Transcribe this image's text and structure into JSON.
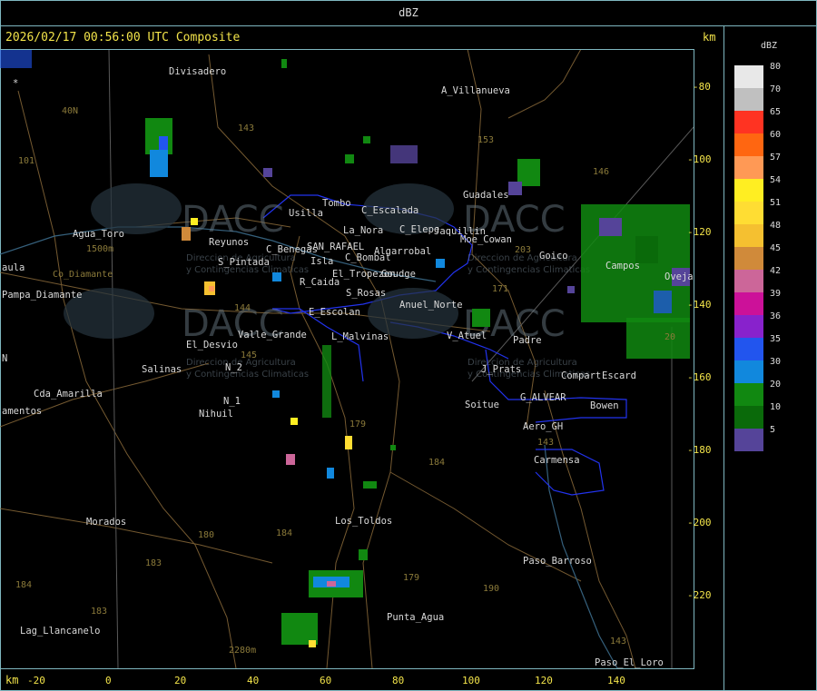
{
  "header": {
    "unit_title": "dBZ",
    "timestamp": "2026/02/17 00:56:00 UTC Composite",
    "km_top": "km",
    "km_bottom": "km"
  },
  "legend": {
    "title": "dBZ",
    "items": [
      {
        "value": "80",
        "color": "#e8e8e8"
      },
      {
        "value": "70",
        "color": "#c0c0c0"
      },
      {
        "value": "65",
        "color": "#ff3322"
      },
      {
        "value": "60",
        "color": "#ff6611"
      },
      {
        "value": "57",
        "color": "#ff9955"
      },
      {
        "value": "54",
        "color": "#ffee22"
      },
      {
        "value": "51",
        "color": "#ffdd33"
      },
      {
        "value": "48",
        "color": "#f5c030"
      },
      {
        "value": "45",
        "color": "#d08a3a"
      },
      {
        "value": "42",
        "color": "#cc6699"
      },
      {
        "value": "39",
        "color": "#cc1199"
      },
      {
        "value": "36",
        "color": "#8822cc"
      },
      {
        "value": "35",
        "color": "#2255ee"
      },
      {
        "value": "30",
        "color": "#1188dd"
      },
      {
        "value": "20",
        "color": "#118811"
      },
      {
        "value": "10",
        "color": "#0a6a0a"
      },
      {
        "value": "5",
        "color": "#554499"
      }
    ]
  },
  "axes": {
    "x_ticks": [
      "-20",
      "0",
      "20",
      "40",
      "60",
      "80",
      "100",
      "120",
      "140"
    ],
    "y_ticks": [
      "-80",
      "-100",
      "-120",
      "-140",
      "-160",
      "-180",
      "-200",
      "-220"
    ]
  },
  "places": [
    "Divisadero",
    "A_Villanueva",
    "40N",
    "101",
    "Agua_Toro",
    "1500m",
    "aula",
    "Co_Diamante",
    "Pampa_Diamante",
    "Reyunos",
    "S_Pintada",
    "Usilla",
    "Tombo",
    "C_Escalada",
    "La_Nora",
    "C_Elepe",
    "Jaquillin",
    "Moe_Cowan",
    "SAN_RAFAEL",
    "Algarrobal",
    "C_Benegas",
    "C_Bombal",
    "Isla",
    "El_Tropezon",
    "Goudge",
    "R_Caida",
    "S_Rosas",
    "Anuel_Norte",
    "E_Escolan",
    "L_Malvinas",
    "Valle_Grande",
    "El_Desvio",
    "V_Atuel",
    "Padre",
    "Guadales",
    "Goico",
    "Campos",
    "Oveja",
    "Salinas",
    "N_2",
    "N_1",
    "Nihuil",
    "Cda_Amarilla",
    "amentos",
    "J_Prats",
    "Compart",
    "Escard",
    "G_ALVEAR",
    "Bowen",
    "Soitue",
    "Aero_GH",
    "Carmensa",
    "Morados",
    "Los_Toldos",
    "Paso_Barroso",
    "Punta_Agua",
    "184",
    "183",
    "Lag_Llancanelo",
    "2280m",
    "Paso_El_Loro",
    "N",
    "*"
  ],
  "routes": [
    "143",
    "153",
    "146",
    "203",
    "171",
    "179",
    "184",
    "180",
    "184",
    "179",
    "190",
    "183",
    "143",
    "144",
    "145",
    "20",
    "143"
  ],
  "watermark": {
    "brand": "DACC",
    "line1": "Direccion de Agricultura",
    "line2": "y Contingencias Climaticas"
  },
  "colors": {
    "frame": "#7fb7c0",
    "timestamp": "#f3e44a",
    "boundary_blue": "#2233ee",
    "roads": "#8a6a3a",
    "grid": "#5a5a5a"
  }
}
